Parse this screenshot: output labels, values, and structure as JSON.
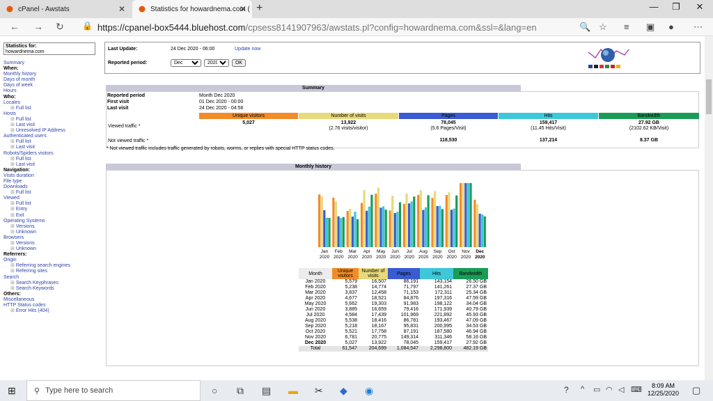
{
  "browser": {
    "tab1": "cPanel - Awstats",
    "tab2": "Statistics for howardnema.com (",
    "url_host": "https://cpanel-box5444.bluehost.com",
    "url_path": "/cpsess8141907963/awstats.pl?config=howardnema.com&ssl=&lang=en"
  },
  "sidebar": {
    "stats_for_label": "Statistics for:",
    "stats_for_value": "howardnema.com",
    "items": [
      {
        "t": "Summary",
        "k": "l"
      },
      {
        "t": "When:",
        "k": "h"
      },
      {
        "t": "Monthly history",
        "k": "l"
      },
      {
        "t": "Days of month",
        "k": "l"
      },
      {
        "t": "Days of week",
        "k": "l"
      },
      {
        "t": "Hours",
        "k": "l"
      },
      {
        "t": "Who:",
        "k": "h"
      },
      {
        "t": "Locales",
        "k": "l"
      },
      {
        "t": "Full list",
        "k": "s"
      },
      {
        "t": "Hosts",
        "k": "l"
      },
      {
        "t": "Full list",
        "k": "s"
      },
      {
        "t": "Last visit",
        "k": "s"
      },
      {
        "t": "Unresolved IP Address",
        "k": "s"
      },
      {
        "t": "Authenticated users",
        "k": "l"
      },
      {
        "t": "Full list",
        "k": "s"
      },
      {
        "t": "Last visit",
        "k": "s"
      },
      {
        "t": "Robots/Spiders visitors",
        "k": "l"
      },
      {
        "t": "Full list",
        "k": "s"
      },
      {
        "t": "Last visit",
        "k": "s"
      },
      {
        "t": "Navigation:",
        "k": "h"
      },
      {
        "t": "Visits duration",
        "k": "l"
      },
      {
        "t": "File type",
        "k": "l"
      },
      {
        "t": "Downloads",
        "k": "l"
      },
      {
        "t": "Full list",
        "k": "s"
      },
      {
        "t": "Viewed",
        "k": "l"
      },
      {
        "t": "Full list",
        "k": "s"
      },
      {
        "t": "Entry",
        "k": "s"
      },
      {
        "t": "Exit",
        "k": "s"
      },
      {
        "t": "Operating Systems",
        "k": "l"
      },
      {
        "t": "Versions",
        "k": "s"
      },
      {
        "t": "Unknown",
        "k": "s"
      },
      {
        "t": "Browsers",
        "k": "l"
      },
      {
        "t": "Versions",
        "k": "s"
      },
      {
        "t": "Unknown",
        "k": "s"
      },
      {
        "t": "Referrers:",
        "k": "h"
      },
      {
        "t": "Origin",
        "k": "l"
      },
      {
        "t": "Referring search engines",
        "k": "s"
      },
      {
        "t": "Referring sites",
        "k": "s"
      },
      {
        "t": "Search",
        "k": "l"
      },
      {
        "t": "Search Keyphrases",
        "k": "s"
      },
      {
        "t": "Search Keywords",
        "k": "s"
      },
      {
        "t": "Others:",
        "k": "h"
      },
      {
        "t": "Miscellaneous",
        "k": "l"
      },
      {
        "t": "HTTP Status codes",
        "k": "l"
      },
      {
        "t": "Error Hits (404)",
        "k": "s"
      }
    ]
  },
  "top": {
    "last_update_label": "Last Update:",
    "last_update_value": "24 Dec 2020 - 06:00",
    "update_now": "Update now",
    "reported_period_label": "Reported period:",
    "month": "Dec",
    "year": "2020",
    "ok": "OK"
  },
  "summary": {
    "title": "Summary",
    "reported_period_label": "Reported period",
    "reported_period_value": "Month Dec 2020",
    "first_visit_label": "First visit",
    "first_visit_value": "01 Dec 2020 - 00:00",
    "last_visit_label": "Last visit",
    "last_visit_value": "24 Dec 2020 - 04:56",
    "headers": [
      "Unique visitors",
      "Number of visits",
      "Pages",
      "Hits",
      "Bandwidth"
    ],
    "viewed_label": "Viewed traffic *",
    "viewed": [
      "5,027",
      "13,922",
      "78,045",
      "159,417",
      "27.92 GB"
    ],
    "viewed_sub": [
      "",
      "(2.76 visits/visitor)",
      "(5.6 Pages/Visit)",
      "(11.45 Hits/Visit)",
      "(2102.62 KB/Visit)"
    ],
    "not_viewed_label": "Not viewed traffic *",
    "not_viewed": [
      "",
      "",
      "118,530",
      "137,214",
      "8.37 GB"
    ],
    "note": "* Not viewed traffic includes traffic generated by robots, worms, or replies with special HTTP status codes."
  },
  "monthly": {
    "title": "Monthly history",
    "headers": [
      "Month",
      "Unique visitors",
      "Number of visits",
      "Pages",
      "Hits",
      "Bandwidth"
    ],
    "rows": [
      [
        "Jan 2020",
        "5,579",
        "16,507",
        "86,191",
        "143,154",
        "26.50 GB"
      ],
      [
        "Feb 2020",
        "5,238",
        "14,774",
        "71,797",
        "141,261",
        "27.37 GB"
      ],
      [
        "Mar 2020",
        "3,837",
        "12,458",
        "71,153",
        "172,311",
        "25.34 GB"
      ],
      [
        "Apr 2020",
        "4,677",
        "18,521",
        "84,876",
        "197,316",
        "47.59 GB"
      ],
      [
        "May 2020",
        "5,662",
        "19,303",
        "91,983",
        "198,122",
        "34.04 GB"
      ],
      [
        "Jun 2020",
        "3,885",
        "16,659",
        "79,416",
        "171,939",
        "40.79 GB"
      ],
      [
        "Jul 2020",
        "4,584",
        "17,439",
        "101,969",
        "221,892",
        "45.93 GB"
      ],
      [
        "Aug 2020",
        "5,538",
        "18,416",
        "86,781",
        "193,467",
        "47.09 GB"
      ],
      [
        "Sep 2020",
        "5,218",
        "18,167",
        "95,831",
        "200,995",
        "34.53 GB"
      ],
      [
        "Oct 2020",
        "5,521",
        "17,758",
        "87,191",
        "187,580",
        "46.94 GB"
      ],
      [
        "Nov 2020",
        "6,781",
        "20,775",
        "149,314",
        "311,346",
        "58.16 GB"
      ],
      [
        "Dec 2020",
        "5,027",
        "13,922",
        "78,045",
        "159,417",
        "27.92 GB"
      ]
    ],
    "total": [
      "Total",
      "61,547",
      "204,699",
      "1,084,547",
      "2,298,800",
      "482.19 GB"
    ]
  },
  "chart_data": {
    "type": "bar",
    "categories": [
      "Jan 2020",
      "Feb 2020",
      "Mar 2020",
      "Apr 2020",
      "May 2020",
      "Jun 2020",
      "Jul 2020",
      "Aug 2020",
      "Sep 2020",
      "Oct 2020",
      "Nov 2020",
      "Dec 2020"
    ],
    "series": [
      {
        "name": "Unique visitors",
        "values": [
          5579,
          5238,
          3837,
          4677,
          5662,
          3885,
          4584,
          5538,
          5218,
          5521,
          6781,
          5027
        ]
      },
      {
        "name": "Number of visits",
        "values": [
          16507,
          14774,
          12458,
          18521,
          19303,
          16659,
          17439,
          18416,
          18167,
          17758,
          20775,
          13922
        ]
      },
      {
        "name": "Pages",
        "values": [
          86191,
          71797,
          71153,
          84876,
          91983,
          79416,
          101969,
          86781,
          95831,
          87191,
          149314,
          78045
        ]
      },
      {
        "name": "Hits",
        "values": [
          143154,
          141261,
          172311,
          197316,
          198122,
          171939,
          221892,
          193467,
          200995,
          187580,
          311346,
          159417
        ]
      },
      {
        "name": "Bandwidth",
        "values": [
          26.5,
          27.37,
          25.34,
          47.59,
          34.04,
          40.79,
          45.93,
          47.09,
          34.53,
          46.94,
          58.16,
          27.92
        ]
      }
    ],
    "colors": [
      "#f28c28",
      "#e8d97a",
      "#3a5bd1",
      "#3ec7d8",
      "#1a9c56"
    ]
  },
  "taskbar": {
    "search": "Type here to search",
    "time": "8:09 AM",
    "date": "12/25/2020"
  }
}
